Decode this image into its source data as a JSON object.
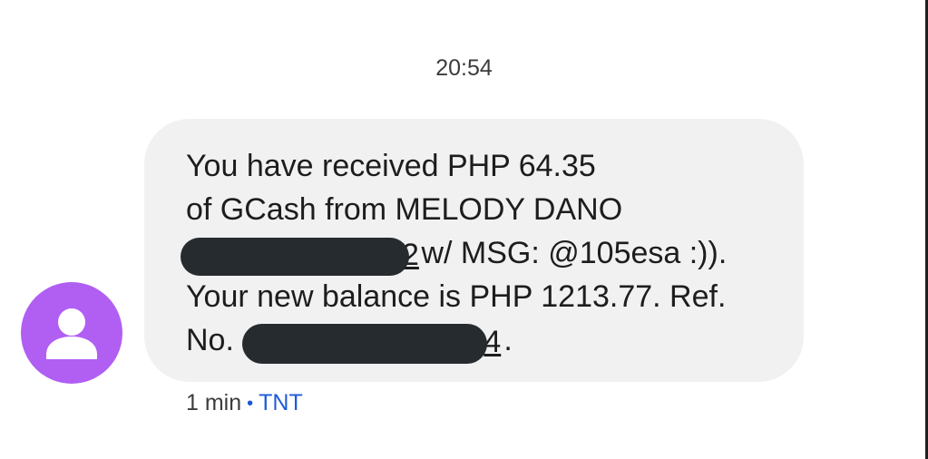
{
  "header": {
    "time": "20:54"
  },
  "contact": {
    "avatar_icon": "person-icon",
    "avatar_color": "#b05ff2"
  },
  "message": {
    "line1": "You have received PHP 64.35",
    "line2": "of GCash from MELODY DANO",
    "line3_tail_char": "2",
    "line3_rest": " w/ MSG: @105esa :)).",
    "line4": "Your new balance is PHP 1213.77. Ref.",
    "line5_prefix": "No. ",
    "line5_tail_char": "4",
    "line5_suffix": "."
  },
  "footer": {
    "age": "1 min",
    "separator": "•",
    "carrier": "TNT"
  },
  "colors": {
    "bubble": "#f1f1f1",
    "redaction": "#262b30",
    "carrier_link": "#1f5bd8"
  }
}
